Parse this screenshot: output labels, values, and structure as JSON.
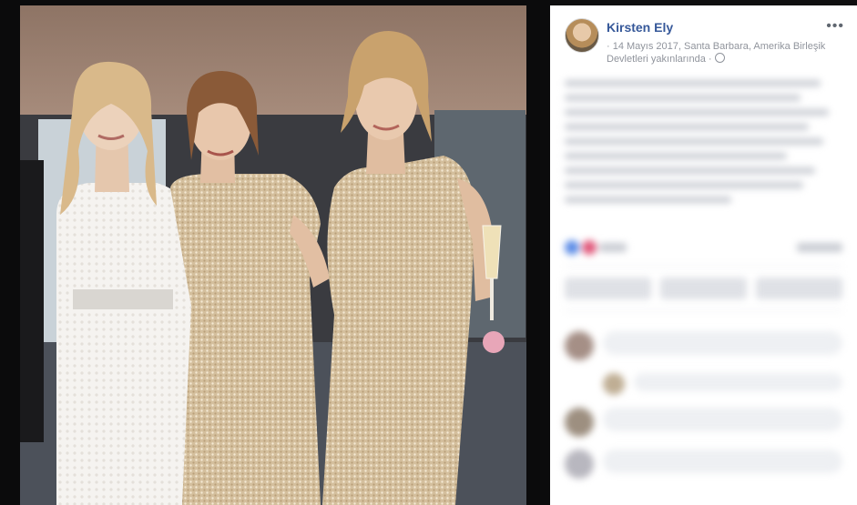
{
  "post": {
    "author": "Kirsten Ely",
    "meta": "· 14 Mayıs 2017, Santa Barbara, Amerika Birleşik Devletleri yakınlarında ·",
    "more_icon": "ellipsis-icon",
    "privacy_icon": "globe-icon"
  },
  "colors": {
    "author_link": "#365899",
    "meta_text": "#90949c",
    "dress_gold": "#d7c2a1",
    "wedding_dress": "#f3f1ee"
  }
}
